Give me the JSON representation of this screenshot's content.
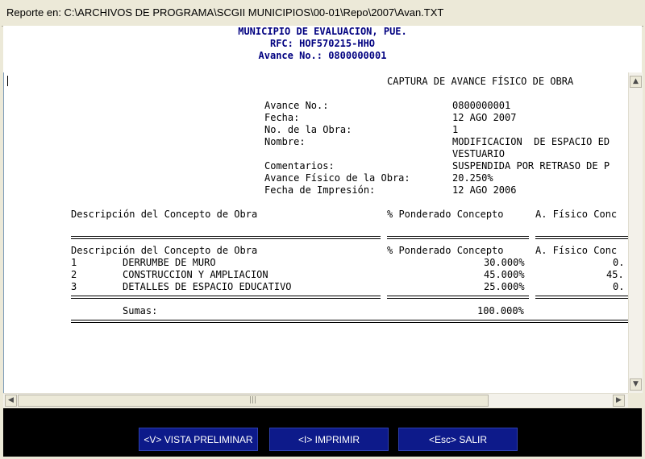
{
  "window": {
    "title": "Reporte en: C:\\ARCHIVOS DE PROGRAMA\\SCGII MUNICIPIOS\\00-01\\Repo\\2007\\Avan.TXT"
  },
  "header": {
    "line1": "MUNICIPIO DE EVALUACION, PUE.",
    "line2": "RFC: HOF570215-HHO",
    "line3": "Avance No.: 0800000001"
  },
  "report": {
    "title": "CAPTURA DE AVANCE FÍSICO DE OBRA",
    "fields": [
      {
        "label": "Avance No.:",
        "value": "0800000001"
      },
      {
        "label": "Fecha:",
        "value": "12 AGO 2007"
      },
      {
        "label": "No. de la Obra:",
        "value": "1"
      },
      {
        "label": "Nombre:",
        "value": "MODIFICACION  DE ESPACIO ED"
      },
      {
        "label": "",
        "value": "VESTUARIO"
      },
      {
        "label": "Comentarios:",
        "value": "SUSPENDIDA POR RETRASO DE P"
      },
      {
        "label": "Avance Físico de la Obra:",
        "value": "20.250%"
      },
      {
        "label": "Fecha de Impresión:",
        "value": "12 AGO 2006"
      }
    ],
    "columns_top": {
      "descripcion": "Descripción del Concepto de Obra",
      "ponderado": "% Ponderado Concepto",
      "fisico": "A. Físico Conc"
    },
    "columns": {
      "descripcion": "Descripción del Concepto de Obra",
      "ponderado": "% Ponderado Concepto",
      "fisico": "A. Físico Conc"
    },
    "rows": [
      {
        "num": "1",
        "desc": "DERRUMBE DE MURO",
        "ponderado": "30.000%",
        "fisico": "0."
      },
      {
        "num": "2",
        "desc": "CONSTRUCCION Y AMPLIACION",
        "ponderado": "45.000%",
        "fisico": "45."
      },
      {
        "num": "3",
        "desc": "DETALLES DE ESPACIO EDUCATIVO",
        "ponderado": "25.000%",
        "fisico": "0."
      }
    ],
    "sumas_label": "Sumas:",
    "sumas_value": "100.000%"
  },
  "scrollbar": {
    "thumb_grip": "|||"
  },
  "buttons": {
    "preview": "<V> VISTA PRELIMINAR",
    "print": "<I> IMPRIMIR",
    "exit": "<Esc> SALIR"
  }
}
